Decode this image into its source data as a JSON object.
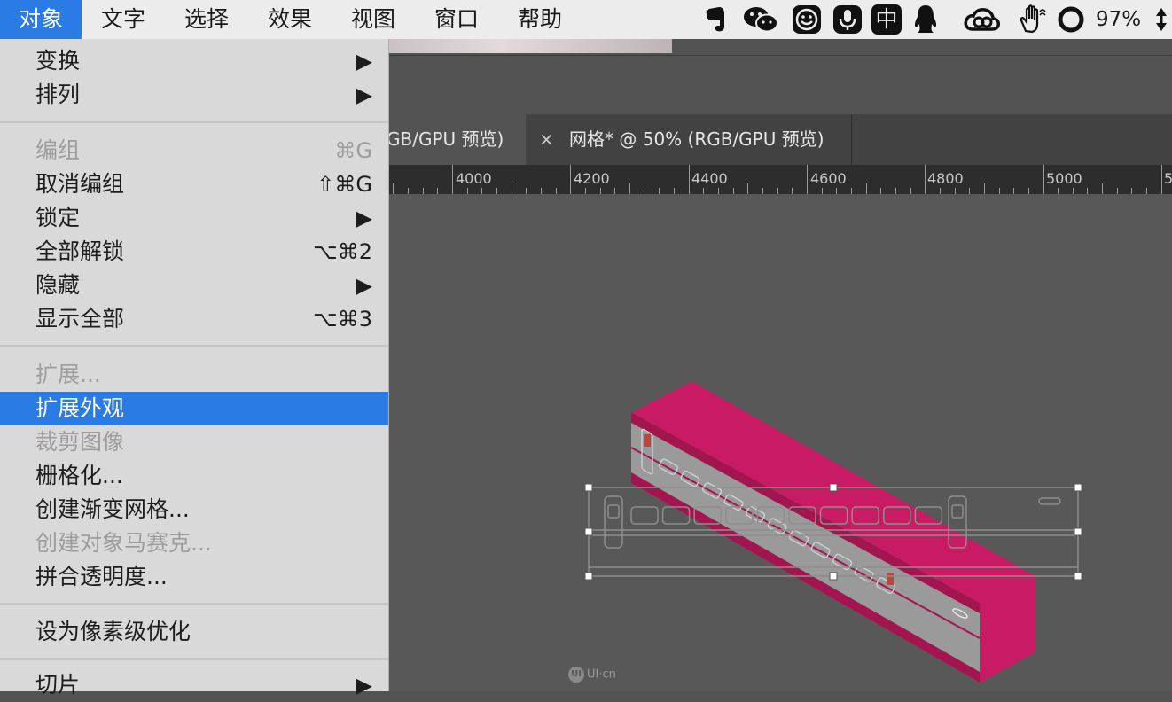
{
  "menubar": {
    "items": [
      {
        "label": "对象"
      },
      {
        "label": "文字"
      },
      {
        "label": "选择"
      },
      {
        "label": "效果"
      },
      {
        "label": "视图"
      },
      {
        "label": "窗口"
      },
      {
        "label": "帮助"
      }
    ],
    "tray": {
      "icons": [
        "evernote-icon",
        "wechat-icon",
        "smiley-icon",
        "microphone-icon",
        "chinese-input-icon",
        "qq-penguin-icon",
        "creative-cloud-icon",
        "hand-icon",
        "battery-ring-icon",
        "updown-arrows-icon"
      ],
      "input_method_label": "中",
      "battery_percent": "97%"
    }
  },
  "dropdown": {
    "items": [
      {
        "label": "变换",
        "shortcut": "▶",
        "disabled": false
      },
      {
        "label": "排列",
        "shortcut": "▶",
        "disabled": false
      },
      {
        "label": "编组",
        "shortcut": "⌘G",
        "disabled": true
      },
      {
        "label": "取消编组",
        "shortcut": "⇧⌘G",
        "disabled": false
      },
      {
        "label": "锁定",
        "shortcut": "▶",
        "disabled": false
      },
      {
        "label": "全部解锁",
        "shortcut": "⌥⌘2",
        "disabled": false
      },
      {
        "label": "隐藏",
        "shortcut": "▶",
        "disabled": false
      },
      {
        "label": "显示全部",
        "shortcut": "⌥⌘3",
        "disabled": false
      },
      {
        "label": "扩展...",
        "shortcut": "",
        "disabled": true
      },
      {
        "label": "扩展外观",
        "shortcut": "",
        "disabled": false,
        "highlighted": true
      },
      {
        "label": "裁剪图像",
        "shortcut": "",
        "disabled": true
      },
      {
        "label": "栅格化...",
        "shortcut": "",
        "disabled": false
      },
      {
        "label": "创建渐变网格...",
        "shortcut": "",
        "disabled": false
      },
      {
        "label": "创建对象马赛克...",
        "shortcut": "",
        "disabled": true
      },
      {
        "label": "拼合透明度...",
        "shortcut": "",
        "disabled": false
      },
      {
        "label": "设为像素级优化",
        "shortcut": "",
        "disabled": false
      },
      {
        "label": "切片",
        "shortcut": "▶",
        "disabled": false
      }
    ]
  },
  "tabs": [
    {
      "label": "GB/GPU 预览)"
    },
    {
      "close": "×",
      "label": "网格* @ 50% (RGB/GPU 预览)"
    }
  ],
  "ruler": {
    "labels": [
      "4000",
      "4200",
      "4400",
      "4600",
      "4800",
      "5000",
      "5"
    ]
  },
  "canvas": {
    "watermark": "UI·cn",
    "watermark_mark": "UI",
    "object_color": "#c81b63",
    "selection_color": "#8a8a8a"
  },
  "colors": {
    "accent": "#2a7be4",
    "menu_bg": "#d9d9d9",
    "disabled_text": "#9d9d9d"
  }
}
